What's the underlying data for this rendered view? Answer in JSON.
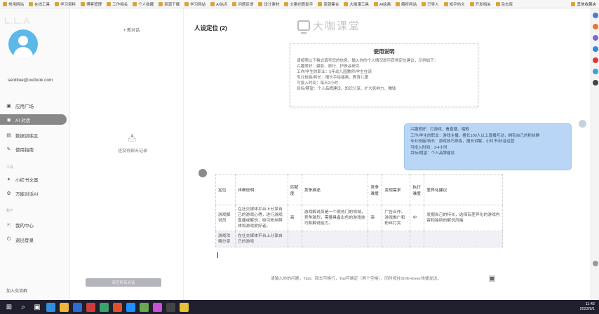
{
  "bookmarks": [
    {
      "label": "常用网站",
      "color": "#d9a43a"
    },
    {
      "label": "在线工具",
      "color": "#d9a43a"
    },
    {
      "label": "学习资料",
      "color": "#d9a43a"
    },
    {
      "label": "博客管理",
      "color": "#d9a43a"
    },
    {
      "label": "工作相关",
      "color": "#d9a43a"
    },
    {
      "label": "个人收藏",
      "color": "#d9a43a"
    },
    {
      "label": "资源下载",
      "color": "#d9a43a"
    },
    {
      "label": "学习网站",
      "color": "#d9a43a"
    },
    {
      "label": "AI站点",
      "color": "#d9a43a"
    },
    {
      "label": "问题反馈",
      "color": "#d9a43a"
    },
    {
      "label": "设计素材",
      "color": "#d9a43a"
    },
    {
      "label": "文案创意助手",
      "color": "#d9a43a"
    },
    {
      "label": "资源集合",
      "color": "#d9a43a"
    },
    {
      "label": "大咖课工具",
      "color": "#d9a43a"
    },
    {
      "label": "AI绘画",
      "color": "#d9a43a"
    },
    {
      "label": "解析网站",
      "color": "#d9a43a"
    },
    {
      "label": "已导入",
      "color": "#d9a43a"
    },
    {
      "label": "知乎热文",
      "color": "#d9a43a"
    },
    {
      "label": "开发相关",
      "color": "#d9a43a"
    },
    {
      "label": "杂志库",
      "color": "#d9a43a"
    }
  ],
  "bookmarks_other": "其他收藏夹",
  "sidebar": {
    "watermark": "L.L.A",
    "email": "seoblue@outlook.com",
    "items": [
      {
        "icon": "▣",
        "icon_name": "app-square-icon",
        "label": "应用广场",
        "active": false
      },
      {
        "icon": "◉",
        "icon_name": "ai-chat-icon",
        "label": "AI 对话",
        "active": true
      },
      {
        "icon": "▤",
        "icon_name": "document-icon",
        "label": "数据训练区",
        "active": false
      },
      {
        "icon": "✎",
        "icon_name": "edit-icon",
        "label": "使用指南",
        "active": false
      }
    ],
    "section2_label": "工具",
    "items2": [
      {
        "icon": "✦",
        "icon_name": "star-icon",
        "label": "小红书文案",
        "active": false
      },
      {
        "icon": "⚙",
        "icon_name": "gear-icon",
        "label": "万能对话AI",
        "active": false
      }
    ],
    "section3_label": "账户",
    "items3": [
      {
        "icon": "☉",
        "icon_name": "user-center-icon",
        "label": "我的中心",
        "active": false
      },
      {
        "icon": "⏻",
        "icon_name": "logout-icon",
        "label": "退出登录",
        "active": false
      }
    ],
    "bottom_link": "加入交流群"
  },
  "history": {
    "new_chat": "+ 新对话",
    "empty_text": "还没有聊天记录",
    "clear_button": "清空所有对话"
  },
  "main": {
    "title": "人设定位 (2)",
    "brand": "大咖课堂",
    "card": {
      "title": "使用说明",
      "lines": [
        "请按照以下格式填写您的信息，输入你的个人情况即可获得定位建议，示例如下：",
        "兴趣爱好：摄影、旅行、护肤品研究",
        "工作/学生的职业：5年幼儿园教师/学生在读",
        "专业技能/特长：擅长手绘插画、教育儿童",
        "可投入时间：每天2小时",
        "目标/期望：个人品牌建设、知识分享、扩大影响力、赚钱"
      ]
    },
    "user_message": [
      "兴趣爱好：打游戏、看直播、唱歌",
      "工作/学生的职业：游戏主播，擅长100人以上直播互动，拥有自己的粉丝群",
      "专业技能/特长：游戏技巧熟练，擅长讲解，小红书/抖音运营",
      "可投入时间：3-4小时",
      "目标/期望：个人品牌建设"
    ],
    "table": {
      "headers": [
        "定位",
        "详细说明",
        "匹配度",
        "竞争描述",
        "竞争难度",
        "变现需求",
        "执行难度",
        "差异化建议"
      ],
      "rows": [
        [
          "游戏解说员",
          "在社交媒体平台上分享自己的游戏心得，进行游戏直播或解说，吸引粉丝群体和游戏爱好者。",
          "高",
          "游戏解说员是一个很热门的领域，竞争激烈，需要具备出色的游戏技巧和解说能力。",
          "高",
          "广告合作、游戏推广和粉丝打赏",
          "中",
          "发掘自己的特长，选择有差异化的游戏内容和独特的解说风格"
        ],
        [
          "游戏攻略分享",
          "在社交媒体平台上分享自己的游戏",
          "",
          "",
          "",
          "",
          "",
          ""
        ]
      ]
    },
    "input_hint": "请输入你的问题，Tips：回车可换行，Tab可确定（两个空格），同时按住Shift+Enter快捷发送。"
  },
  "taskbar": {
    "time": "11:42",
    "date": "2023/9/1"
  }
}
